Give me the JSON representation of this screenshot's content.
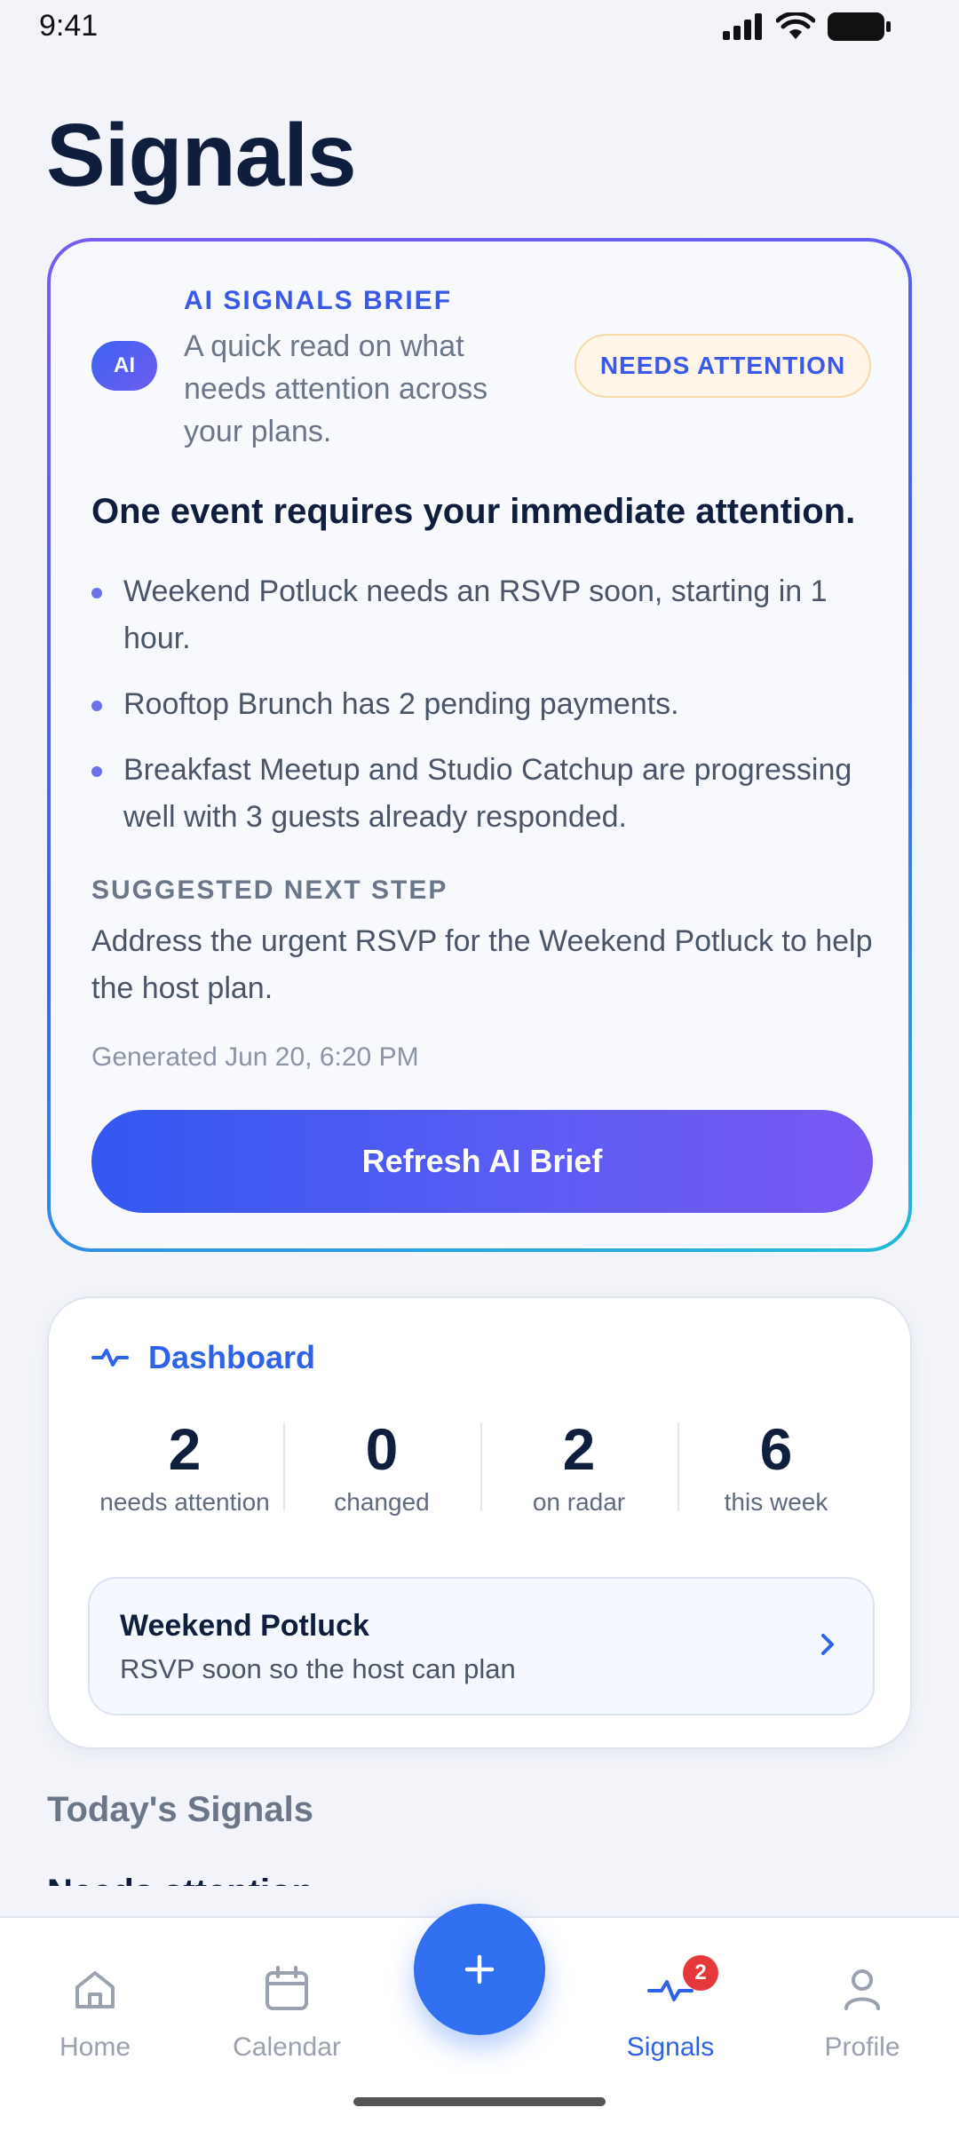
{
  "status_bar": {
    "time": "9:41"
  },
  "page": {
    "title": "Signals"
  },
  "ai_brief": {
    "badge": "AI",
    "eyebrow": "AI SIGNALS BRIEF",
    "subtitle": "A quick read on what needs attention across your plans.",
    "status_pill": "NEEDS ATTENTION",
    "headline": "One event requires your immediate attention.",
    "bullets": [
      "Weekend Potluck needs an RSVP soon, starting in 1 hour.",
      "Rooftop Brunch has 2 pending payments.",
      "Breakfast Meetup and Studio Catchup are progressing well with 3 guests already responded."
    ],
    "next_step_label": "SUGGESTED NEXT STEP",
    "next_step_text": "Address the urgent RSVP for the Weekend Potluck to help the host plan.",
    "generated": "Generated Jun 20, 6:20 PM",
    "refresh_label": "Refresh AI Brief"
  },
  "dashboard": {
    "title": "Dashboard",
    "icon": "pulse-icon",
    "stats": [
      {
        "value": "2",
        "label": "needs attention"
      },
      {
        "value": "0",
        "label": "changed"
      },
      {
        "value": "2",
        "label": "on radar"
      },
      {
        "value": "6",
        "label": "this week"
      }
    ],
    "highlight": {
      "name": "Weekend Potluck",
      "description": "RSVP soon so the host can plan"
    }
  },
  "today": {
    "title": "Today's Signals",
    "subtitle": "Needs attention"
  },
  "nav": {
    "items": [
      {
        "label": "Home",
        "icon": "home-icon"
      },
      {
        "label": "Calendar",
        "icon": "calendar-icon"
      },
      {
        "label": "Signals",
        "icon": "pulse-icon",
        "badge": "2"
      },
      {
        "label": "Profile",
        "icon": "person-icon"
      }
    ],
    "fab_icon": "plus-icon"
  },
  "colors": {
    "accent": "#2f63e6",
    "background": "#f2f4f9",
    "badge": "#e5383b"
  }
}
